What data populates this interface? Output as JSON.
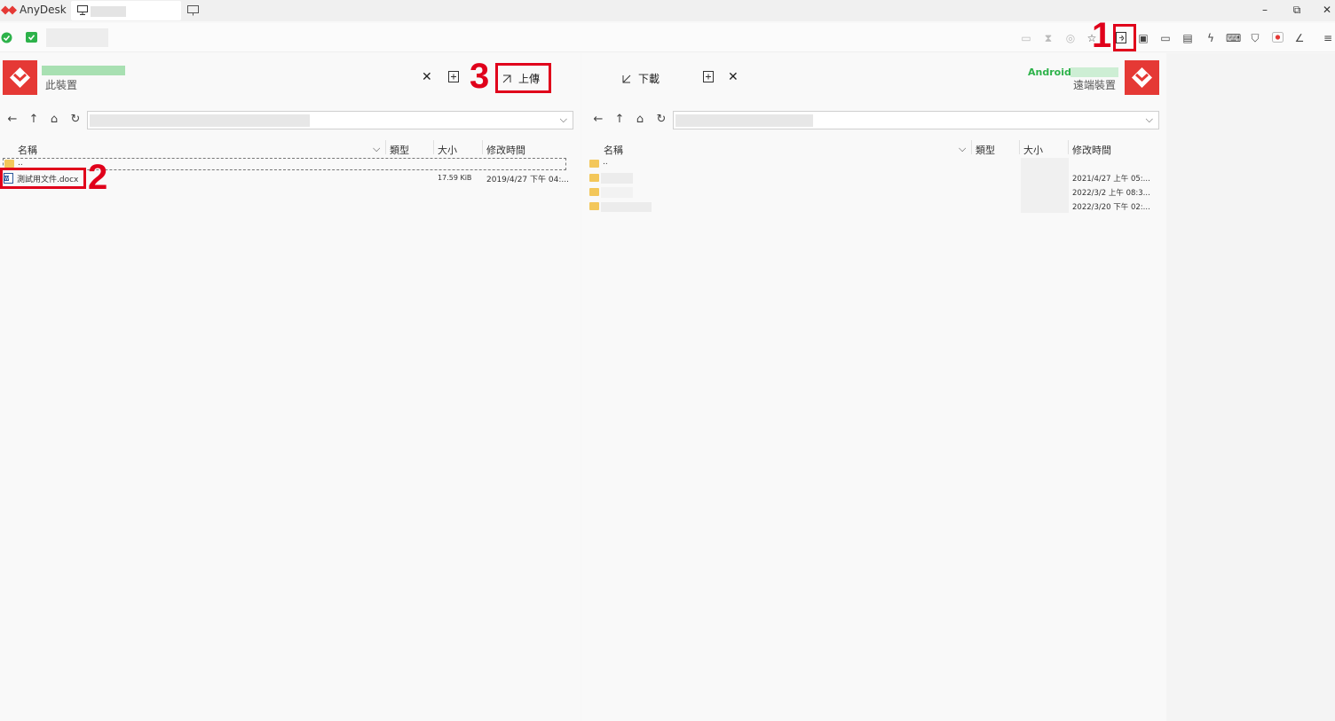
{
  "titlebar": {
    "app_name": "AnyDesk",
    "minimize": "–",
    "restore": "⧉",
    "close": "✕"
  },
  "local": {
    "device_label": "此裝置",
    "close_label": "✕",
    "upload_label": "上傳",
    "columns": {
      "name": "名稱",
      "type": "類型",
      "size": "大小",
      "modified": "修改時間"
    },
    "parent_row": "..",
    "file": {
      "name": "測試用文件.docx",
      "size": "17.59 KiB",
      "modified": "2019/4/27 下午 04:..."
    }
  },
  "remote": {
    "device_label": "遠端裝置",
    "device_name": "Android (",
    "download_label": "下載",
    "close_label": "✕",
    "columns": {
      "name": "名稱",
      "type": "類型",
      "size": "大小",
      "modified": "修改時間"
    },
    "parent_row": "..",
    "rows": [
      {
        "modified": "2021/4/27 上午 05:..."
      },
      {
        "modified": "2022/3/2 上午 08:3..."
      },
      {
        "modified": "2022/3/20 下午 02:..."
      }
    ]
  },
  "annotations": {
    "n1": "1",
    "n2": "2",
    "n3": "3"
  },
  "colors": {
    "brand": "#e53935",
    "annotation": "#e0001b",
    "folder": "#f3c75a",
    "online": "#2db24a"
  }
}
